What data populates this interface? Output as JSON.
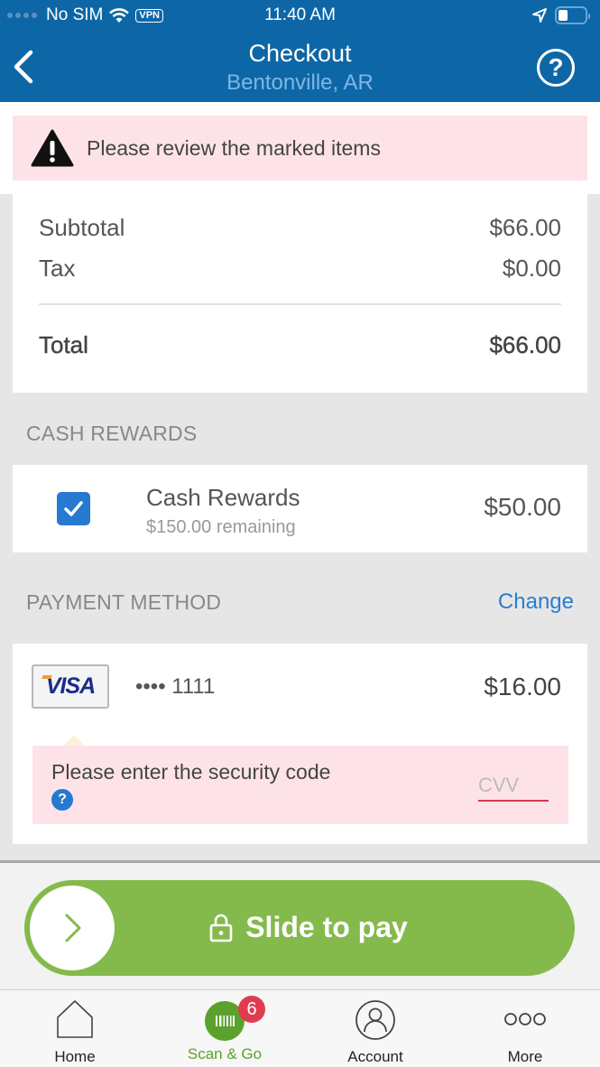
{
  "status_bar": {
    "carrier": "No SIM",
    "vpn_label": "VPN",
    "time": "11:40 AM",
    "icons": [
      "signal-dots-icon",
      "wifi-icon",
      "vpn-icon",
      "location-arrow-icon",
      "battery-icon"
    ]
  },
  "header": {
    "title": "Checkout",
    "subtitle": "Bentonville, AR",
    "back_icon": "chevron-left-icon",
    "help_label": "?"
  },
  "alert": {
    "icon": "warning-triangle-icon",
    "message": "Please review the marked items"
  },
  "summary": {
    "subtotal_label": "Subtotal",
    "subtotal_value": "$66.00",
    "tax_label": "Tax",
    "tax_value": "$0.00",
    "total_label": "Total",
    "total_value": "$66.00"
  },
  "cash_rewards": {
    "section_label": "CASH REWARDS",
    "checked": true,
    "title": "Cash Rewards",
    "remaining": "$150.00 remaining",
    "amount": "$50.00"
  },
  "payment_method": {
    "section_label": "PAYMENT METHOD",
    "change_label": "Change",
    "card_brand": "VISA",
    "card_number": "•••• 1111",
    "amount": "$16.00",
    "cvv_message": "Please enter the security code",
    "cvv_help": "?",
    "cvv_placeholder": "CVV",
    "cvv_value": ""
  },
  "slide_to_pay": {
    "label": "Slide to pay",
    "icons": [
      "chevron-right-icon",
      "lock-icon"
    ]
  },
  "tabbar": {
    "items": [
      {
        "label": "Home",
        "icon": "home-icon",
        "active": false
      },
      {
        "label": "Scan & Go",
        "icon": "barcode-icon",
        "active": true,
        "badge": "6"
      },
      {
        "label": "Account",
        "icon": "user-icon",
        "active": false
      },
      {
        "label": "More",
        "icon": "more-icon",
        "active": false
      }
    ]
  },
  "colors": {
    "header_bg": "#0d67a6",
    "accent_blue": "#2579d1",
    "alert_bg": "#fde3e8",
    "slider_green": "#84ba4c",
    "active_tab_green": "#5aa22b",
    "badge_red": "#e03c50",
    "error_underline": "#d63654"
  }
}
